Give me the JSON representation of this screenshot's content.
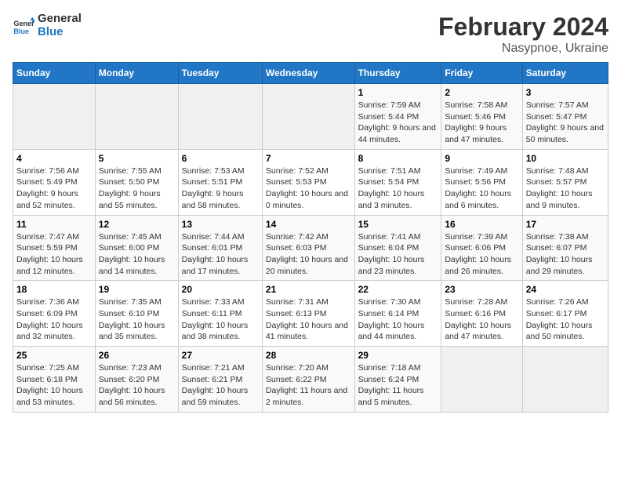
{
  "logo": {
    "line1": "General",
    "line2": "Blue"
  },
  "title": "February 2024",
  "subtitle": "Nasypnoe, Ukraine",
  "days_header": [
    "Sunday",
    "Monday",
    "Tuesday",
    "Wednesday",
    "Thursday",
    "Friday",
    "Saturday"
  ],
  "weeks": [
    [
      {
        "num": "",
        "detail": ""
      },
      {
        "num": "",
        "detail": ""
      },
      {
        "num": "",
        "detail": ""
      },
      {
        "num": "",
        "detail": ""
      },
      {
        "num": "1",
        "detail": "Sunrise: 7:59 AM\nSunset: 5:44 PM\nDaylight: 9 hours and 44 minutes."
      },
      {
        "num": "2",
        "detail": "Sunrise: 7:58 AM\nSunset: 5:46 PM\nDaylight: 9 hours and 47 minutes."
      },
      {
        "num": "3",
        "detail": "Sunrise: 7:57 AM\nSunset: 5:47 PM\nDaylight: 9 hours and 50 minutes."
      }
    ],
    [
      {
        "num": "4",
        "detail": "Sunrise: 7:56 AM\nSunset: 5:49 PM\nDaylight: 9 hours and 52 minutes."
      },
      {
        "num": "5",
        "detail": "Sunrise: 7:55 AM\nSunset: 5:50 PM\nDaylight: 9 hours and 55 minutes."
      },
      {
        "num": "6",
        "detail": "Sunrise: 7:53 AM\nSunset: 5:51 PM\nDaylight: 9 hours and 58 minutes."
      },
      {
        "num": "7",
        "detail": "Sunrise: 7:52 AM\nSunset: 5:53 PM\nDaylight: 10 hours and 0 minutes."
      },
      {
        "num": "8",
        "detail": "Sunrise: 7:51 AM\nSunset: 5:54 PM\nDaylight: 10 hours and 3 minutes."
      },
      {
        "num": "9",
        "detail": "Sunrise: 7:49 AM\nSunset: 5:56 PM\nDaylight: 10 hours and 6 minutes."
      },
      {
        "num": "10",
        "detail": "Sunrise: 7:48 AM\nSunset: 5:57 PM\nDaylight: 10 hours and 9 minutes."
      }
    ],
    [
      {
        "num": "11",
        "detail": "Sunrise: 7:47 AM\nSunset: 5:59 PM\nDaylight: 10 hours and 12 minutes."
      },
      {
        "num": "12",
        "detail": "Sunrise: 7:45 AM\nSunset: 6:00 PM\nDaylight: 10 hours and 14 minutes."
      },
      {
        "num": "13",
        "detail": "Sunrise: 7:44 AM\nSunset: 6:01 PM\nDaylight: 10 hours and 17 minutes."
      },
      {
        "num": "14",
        "detail": "Sunrise: 7:42 AM\nSunset: 6:03 PM\nDaylight: 10 hours and 20 minutes."
      },
      {
        "num": "15",
        "detail": "Sunrise: 7:41 AM\nSunset: 6:04 PM\nDaylight: 10 hours and 23 minutes."
      },
      {
        "num": "16",
        "detail": "Sunrise: 7:39 AM\nSunset: 6:06 PM\nDaylight: 10 hours and 26 minutes."
      },
      {
        "num": "17",
        "detail": "Sunrise: 7:38 AM\nSunset: 6:07 PM\nDaylight: 10 hours and 29 minutes."
      }
    ],
    [
      {
        "num": "18",
        "detail": "Sunrise: 7:36 AM\nSunset: 6:09 PM\nDaylight: 10 hours and 32 minutes."
      },
      {
        "num": "19",
        "detail": "Sunrise: 7:35 AM\nSunset: 6:10 PM\nDaylight: 10 hours and 35 minutes."
      },
      {
        "num": "20",
        "detail": "Sunrise: 7:33 AM\nSunset: 6:11 PM\nDaylight: 10 hours and 38 minutes."
      },
      {
        "num": "21",
        "detail": "Sunrise: 7:31 AM\nSunset: 6:13 PM\nDaylight: 10 hours and 41 minutes."
      },
      {
        "num": "22",
        "detail": "Sunrise: 7:30 AM\nSunset: 6:14 PM\nDaylight: 10 hours and 44 minutes."
      },
      {
        "num": "23",
        "detail": "Sunrise: 7:28 AM\nSunset: 6:16 PM\nDaylight: 10 hours and 47 minutes."
      },
      {
        "num": "24",
        "detail": "Sunrise: 7:26 AM\nSunset: 6:17 PM\nDaylight: 10 hours and 50 minutes."
      }
    ],
    [
      {
        "num": "25",
        "detail": "Sunrise: 7:25 AM\nSunset: 6:18 PM\nDaylight: 10 hours and 53 minutes."
      },
      {
        "num": "26",
        "detail": "Sunrise: 7:23 AM\nSunset: 6:20 PM\nDaylight: 10 hours and 56 minutes."
      },
      {
        "num": "27",
        "detail": "Sunrise: 7:21 AM\nSunset: 6:21 PM\nDaylight: 10 hours and 59 minutes."
      },
      {
        "num": "28",
        "detail": "Sunrise: 7:20 AM\nSunset: 6:22 PM\nDaylight: 11 hours and 2 minutes."
      },
      {
        "num": "29",
        "detail": "Sunrise: 7:18 AM\nSunset: 6:24 PM\nDaylight: 11 hours and 5 minutes."
      },
      {
        "num": "",
        "detail": ""
      },
      {
        "num": "",
        "detail": ""
      }
    ]
  ]
}
